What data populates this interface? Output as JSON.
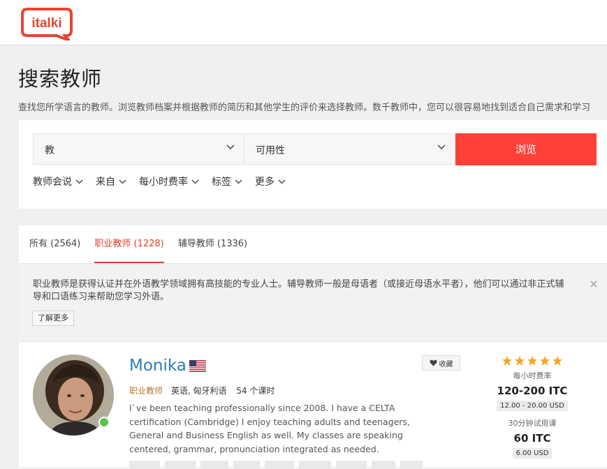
{
  "brand": {
    "logo_text": "italki",
    "color": "#e84532"
  },
  "page": {
    "title": "搜索教师",
    "description": "查找您所学语言的教师。浏览教师档案并根据教师的简历和其他学生的评价来选择教师。数千教师中，您可以很容易地找到适合自己需求和学习"
  },
  "search": {
    "teach_select": "教",
    "availability_select": "可用性",
    "browse_button": "浏览",
    "filters": [
      "教师会说",
      "来自",
      "每小时费率",
      "标签",
      "更多"
    ]
  },
  "tabs": [
    {
      "label": "所有 (2564)",
      "active": false
    },
    {
      "label": "职业教师 (1228)",
      "active": true
    },
    {
      "label": "辅导教师 (1336)",
      "active": false
    }
  ],
  "notice": {
    "text": "职业教师是获得认证并在外语教学领域拥有高技能的专业人士。辅导教师一般是母语者（或接近母语水平者），他们可以通过非正式辅导和口语练习来帮助您学习外语。",
    "learn_more": "了解更多"
  },
  "teacher": {
    "name": "Monika",
    "flag": "us-flag",
    "role": "职业教师",
    "languages": "英语, 匈牙利语",
    "lessons": "54 个课时",
    "bio": "I`ve been teaching professionally since 2008. I have a CELTA certification (Cambridge) I enjoy teaching adults and teenagers, General and Business English as well. My classes are speaking centered, grammar, pronunciation integrated as needed.",
    "favorite_label": "收藏",
    "rating": 5,
    "hourly_rate_label": "每小时费率",
    "hourly_rate_itc": "120-200 ITC",
    "hourly_rate_usd": "12.00 - 20.00 USD",
    "trial_label": "30分钟试用课",
    "trial_itc": "60  ITC",
    "trial_usd": "6.00 USD",
    "online": true
  },
  "colors": {
    "accent": "#ff4138",
    "link": "#2f7cb5",
    "role": "#b57a2c",
    "star": "#f5a623",
    "online": "#5bc24f"
  }
}
